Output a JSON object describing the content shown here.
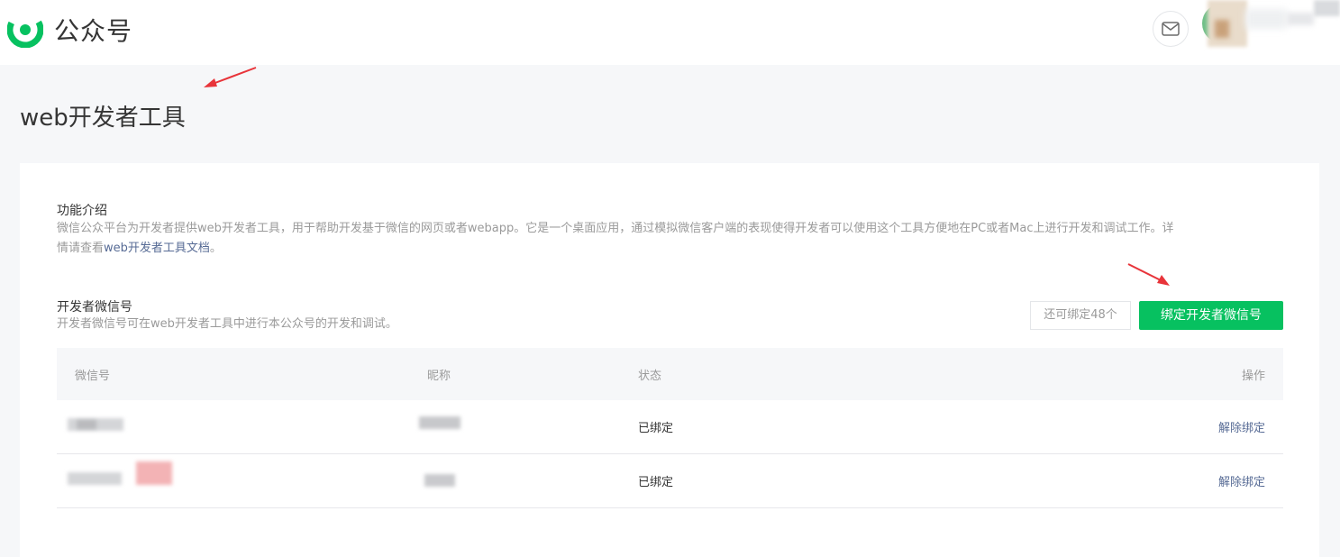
{
  "header": {
    "logo_icon": "wechat-mp-logo-icon",
    "app_name": "公众号",
    "mail_icon": "envelope-icon",
    "brand_color": "#07c160"
  },
  "page": {
    "title": "web开发者工具"
  },
  "intro": {
    "label": "功能介绍",
    "text_before": "微信公众平台为开发者提供web开发者工具，用于帮助开发基于微信的网页或者webapp。它是一个桌面应用，通过模拟微信客户端的表现使得开发者可以使用这个工具方便地在PC或者Mac上进行开发和调试工作。详",
    "text_line2_prefix": "情请查看",
    "doc_link": "web开发者工具文档",
    "text_line2_suffix": "。"
  },
  "developers": {
    "label": "开发者微信号",
    "desc": "开发者微信号可在web开发者工具中进行本公众号的开发和调试。",
    "remaining": "还可绑定48个",
    "bind_button": "绑定开发者微信号",
    "columns": [
      "微信号",
      "昵称",
      "状态",
      "操作"
    ],
    "rows": [
      {
        "status": "已绑定",
        "action": "解除绑定"
      },
      {
        "status": "已绑定",
        "action": "解除绑定"
      }
    ]
  },
  "colors": {
    "accent": "#07c160",
    "link": "#576b95",
    "muted": "#9a9a9a",
    "annotation_arrow": "#e8343a"
  }
}
